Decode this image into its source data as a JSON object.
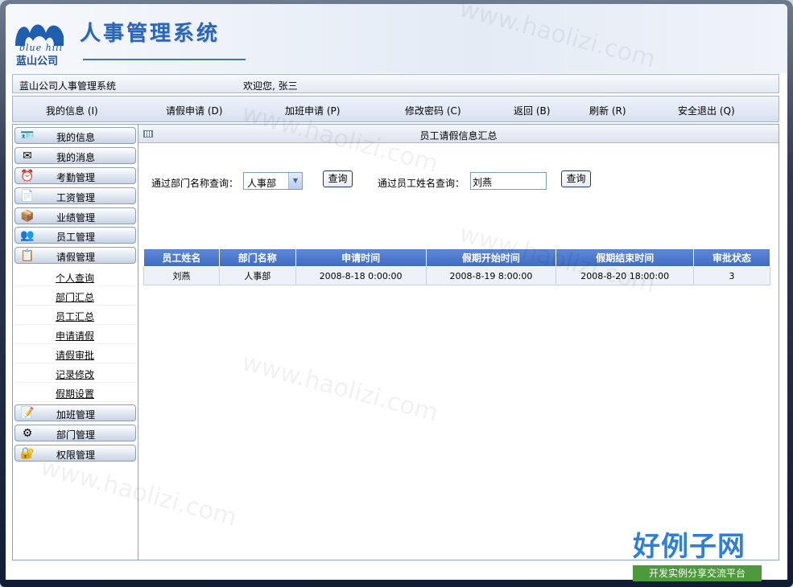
{
  "header": {
    "system_title": "人事管理系统",
    "logo_text": "blue hill",
    "logo_company": "蓝山公司"
  },
  "infobar": {
    "site_name": "蓝山公司人事管理系统",
    "welcome": "欢迎您, 张三"
  },
  "menu": {
    "items": [
      {
        "label": "我的信息 (I)"
      },
      {
        "label": "请假申请 (D)"
      },
      {
        "label": "加班申请 (P)"
      },
      {
        "label": "修改密码 (C)"
      },
      {
        "label": "返回 (B)"
      },
      {
        "label": "刷新 (R)"
      },
      {
        "label": "安全退出 (Q)"
      }
    ]
  },
  "sidebar": {
    "modules": [
      {
        "label": "我的信息",
        "icon": "user-card-icon"
      },
      {
        "label": "我的消息",
        "icon": "message-icon"
      },
      {
        "label": "考勤管理",
        "icon": "clock-icon"
      },
      {
        "label": "工资管理",
        "icon": "salary-icon"
      },
      {
        "label": "业绩管理",
        "icon": "box-icon"
      },
      {
        "label": "员工管理",
        "icon": "people-icon"
      },
      {
        "label": "请假管理",
        "icon": "leave-icon"
      }
    ],
    "sub_items": [
      {
        "label": "个人查询"
      },
      {
        "label": "部门汇总"
      },
      {
        "label": "员工汇总"
      },
      {
        "label": "申请请假"
      },
      {
        "label": "请假审批"
      },
      {
        "label": "记录修改"
      },
      {
        "label": "假期设置"
      }
    ],
    "modules_after": [
      {
        "label": "加班管理",
        "icon": "overtime-icon"
      },
      {
        "label": "部门管理",
        "icon": "department-icon"
      },
      {
        "label": "权限管理",
        "icon": "permission-icon"
      }
    ]
  },
  "panel": {
    "title": "员工请假信息汇总",
    "dept_query_label": "通过部门名称查询：",
    "dept_selected": "人事部",
    "query_button": "查询",
    "name_query_label": "通过员工姓名查询：",
    "name_value": "刘燕"
  },
  "table": {
    "headers": [
      "员工姓名",
      "部门名称",
      "申请时间",
      "假期开始时间",
      "假期结束时间",
      "审批状态"
    ],
    "rows": [
      [
        "刘燕",
        "人事部",
        "2008-8-18  0:00:00",
        "2008-8-19  8:00:00",
        "2008-8-20  18:00:00",
        "3"
      ]
    ]
  },
  "watermark": {
    "site": "www.haolizi.com",
    "brand_big": "好例子网",
    "brand_small": "开发实例分享交流平台"
  }
}
